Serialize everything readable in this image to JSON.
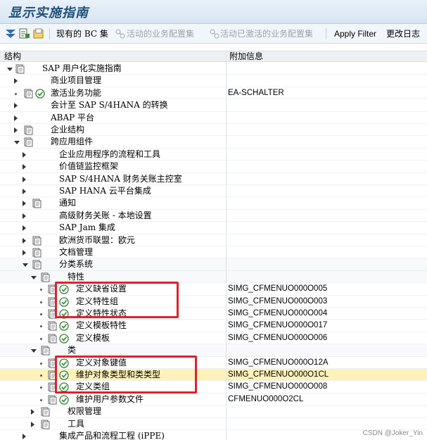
{
  "window": {
    "title": "显示实施指南"
  },
  "toolbar": {
    "bc_set_label": "现有的 BC 集",
    "active_bc_label": "活动的业务配置集",
    "activated_bc_label": "活动已激活的业务配置集",
    "apply_filter_label": "Apply Filter",
    "change_log_label": "更改日志"
  },
  "columns": {
    "structure": "结构",
    "additional_info": "附加信息"
  },
  "tree": [
    {
      "label": "SAP 用户化实施指南",
      "info": ""
    },
    {
      "label": "商业项目管理",
      "info": ""
    },
    {
      "label": "激活业务功能",
      "info": "EA-SCHALTER"
    },
    {
      "label": "会计至 SAP S/4HANA 的转换",
      "info": ""
    },
    {
      "label": "ABAP 平台",
      "info": ""
    },
    {
      "label": "企业结构",
      "info": ""
    },
    {
      "label": "跨应用组件",
      "info": ""
    },
    {
      "label": "企业应用程序的流程和工具",
      "info": ""
    },
    {
      "label": "价值链监控框架",
      "info": ""
    },
    {
      "label": "SAP S/4HANA 财务关账主控室",
      "info": ""
    },
    {
      "label": "SAP HANA 云平台集成",
      "info": ""
    },
    {
      "label": "通知",
      "info": ""
    },
    {
      "label": "高级财务关账 - 本地设置",
      "info": ""
    },
    {
      "label": "SAP Jam 集成",
      "info": ""
    },
    {
      "label": "欧洲货币联盟：欧元",
      "info": ""
    },
    {
      "label": "文档管理",
      "info": ""
    },
    {
      "label": "分类系统",
      "info": ""
    },
    {
      "label": "特性",
      "info": ""
    },
    {
      "label": "定义缺省设置",
      "info": "SIMG_CFMENUO000O005"
    },
    {
      "label": "定义特性组",
      "info": "SIMG_CFMENUO000O003"
    },
    {
      "label": "定义特性状态",
      "info": "SIMG_CFMENUO000O004"
    },
    {
      "label": "定义模板特性",
      "info": "SIMG_CFMENUO000O017"
    },
    {
      "label": "定义模板",
      "info": "SIMG_CFMENUO000O006"
    },
    {
      "label": "类",
      "info": ""
    },
    {
      "label": "定义对象键值",
      "info": "SIMG_CFMENUO000O12A"
    },
    {
      "label": "维护对象类型和类类型",
      "info": "SIMG_CFMENUO000O1CL"
    },
    {
      "label": "定义类组",
      "info": "SIMG_CFMENUO000O008"
    },
    {
      "label": "维护用户参数文件",
      "info": "CFMENUO000O2CL"
    },
    {
      "label": "权限管理",
      "info": ""
    },
    {
      "label": "工具",
      "info": ""
    },
    {
      "label": "集成产品和流程工程 (iPPE)",
      "info": ""
    }
  ],
  "watermark": "CSDN @Joker_Yin",
  "colors": {
    "highlight": "#fff2b8",
    "annotation_box": "#e0202a",
    "title": "#1f4e79"
  }
}
